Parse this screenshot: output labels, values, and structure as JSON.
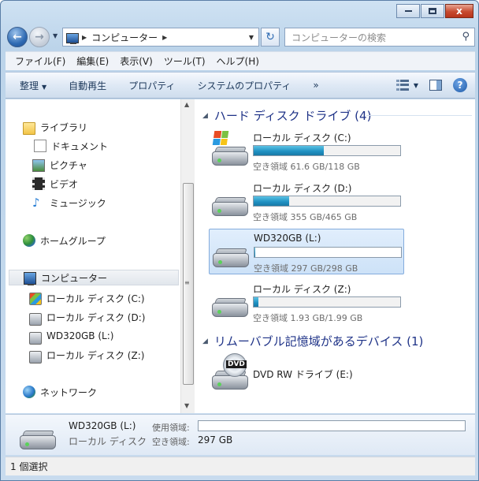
{
  "window": {
    "caption_close": "x"
  },
  "nav": {
    "address_crumb": "コンピューター",
    "search_placeholder": "コンピューターの検索"
  },
  "menu": [
    "ファイル(F)",
    "編集(E)",
    "表示(V)",
    "ツール(T)",
    "ヘルプ(H)"
  ],
  "toolbar": {
    "organize": "整理",
    "autoplay": "自動再生",
    "properties": "プロパティ",
    "system_properties": "システムのプロパティ",
    "more": "»",
    "help": "?"
  },
  "sidebar": {
    "libraries": "ライブラリ",
    "documents": "ドキュメント",
    "pictures": "ピクチャ",
    "videos": "ビデオ",
    "music": "ミュージック",
    "homegroup": "ホームグループ",
    "computer": "コンピューター",
    "drive_c": "ローカル ディスク (C:)",
    "drive_d": "ローカル ディスク (D:)",
    "drive_l": "WD320GB (L:)",
    "drive_z": "ローカル ディスク (Z:)",
    "network": "ネットワーク"
  },
  "groups": {
    "hard_disks": "ハード ディスク ドライブ (4)",
    "removable": "リムーバブル記憶域があるデバイス (1)"
  },
  "drives": [
    {
      "name": "ローカル ディスク (C:)",
      "free": "空き領域 61.6 GB/118 GB",
      "used_pct": 48
    },
    {
      "name": "ローカル ディスク (D:)",
      "free": "空き領域 355 GB/465 GB",
      "used_pct": 24
    },
    {
      "name": "WD320GB (L:)",
      "free": "空き領域 297 GB/298 GB",
      "used_pct": 0.5
    },
    {
      "name": "ローカル ディスク (Z:)",
      "free": "空き領域 1.93 GB/1.99 GB",
      "used_pct": 3
    }
  ],
  "dvd": {
    "name": "DVD RW ドライブ (E:)",
    "badge": "DVD"
  },
  "details": {
    "name": "WD320GB (L:)",
    "type": "ローカル ディスク",
    "used_label": "使用領域:",
    "free_label": "空き領域:",
    "free_value": "297 GB"
  },
  "status": {
    "text": "1 個選択"
  }
}
